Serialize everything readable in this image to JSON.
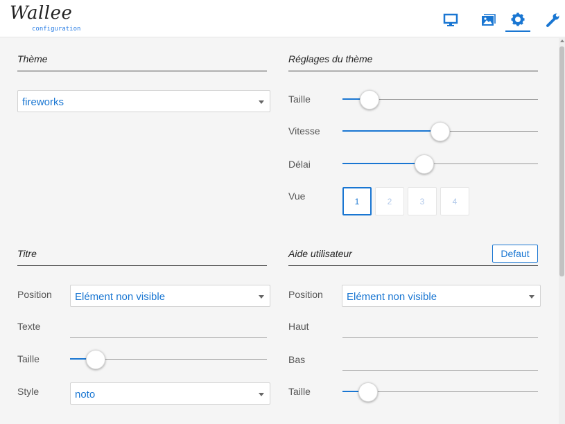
{
  "header": {
    "logo": "Wallee",
    "logo_sub": "configuration",
    "nav": [
      "monitor-icon",
      "images-icon",
      "gear-icon",
      "wrench-icon"
    ],
    "active_nav": "gear-icon"
  },
  "theme": {
    "title": "Thème",
    "selected": "fireworks"
  },
  "theme_settings": {
    "title": "Réglages du thème",
    "size_label": "Taille",
    "size_value": 0.14,
    "speed_label": "Vitesse",
    "speed_value": 0.5,
    "delay_label": "Délai",
    "delay_value": 0.42,
    "view_label": "Vue",
    "views": [
      "1",
      "2",
      "3",
      "4"
    ],
    "active_view": "1"
  },
  "title_section": {
    "title": "Titre",
    "position_label": "Position",
    "position_value": "Elément non visible",
    "text_label": "Texte",
    "text_value": "",
    "size_label": "Taille",
    "size_value": 0.13,
    "style_label": "Style",
    "style_value": "noto"
  },
  "user_help": {
    "title": "Aide utilisateur",
    "default_button": "Defaut",
    "position_label": "Position",
    "position_value": "Elément non visible",
    "top_label": "Haut",
    "top_value": "",
    "bottom_label": "Bas",
    "bottom_value": "",
    "size_label": "Taille",
    "size_value": 0.13
  },
  "colors": {
    "accent": "#1976d2",
    "background": "#f5f5f5"
  }
}
